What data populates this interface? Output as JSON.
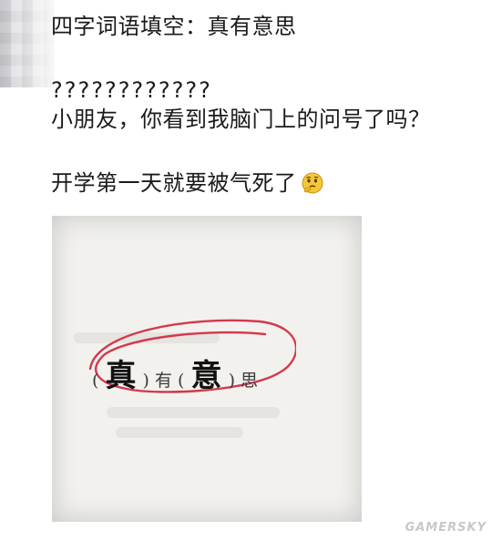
{
  "post": {
    "line1": "四字词语填空：真有意思",
    "line2": "????????????",
    "line3": "小朋友，你看到我脑门上的问号了吗？",
    "line4": "开学第一天就要被气死了"
  },
  "emoji": {
    "name": "thinking-face-icon"
  },
  "worksheet": {
    "open1": "(",
    "answer1": "真",
    "close1": ")",
    "given1": "有",
    "open2": "(",
    "answer2": "意",
    "close2": ")",
    "given2": "思"
  },
  "watermark": "GAMERSKY",
  "colors": {
    "circle": "#d4384a",
    "text": "#1a1a1a",
    "paper": "#f2f1ee"
  }
}
